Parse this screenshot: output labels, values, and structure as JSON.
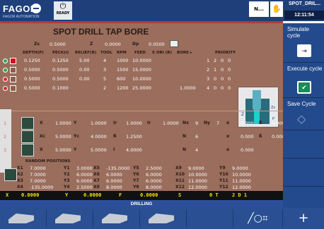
{
  "header": {
    "logo": "FAGOR",
    "logo_sub": "FAGOR AUTOMATION",
    "power_status": "READY",
    "mode_button": "N...",
    "program_name": "SPOT_DRIL...",
    "time": "12:11:54"
  },
  "cycle": {
    "title": "SPOT DRILL TAP BORE",
    "zs": {
      "label": "Zs",
      "value": "0.5000"
    },
    "z": {
      "label": "Z",
      "value": "0.0000"
    },
    "dp": {
      "label": "Dp",
      "value": "0.0500"
    },
    "columns": [
      "DEPTH(P)",
      "PECK(I)",
      "RELIEF(B)",
      "TOOL",
      "RPM",
      "FEED",
      "S ORI (B)",
      "BORE ▸",
      "PRIORITY"
    ],
    "ops": [
      {
        "depth": "0.1250",
        "peck": "0.1250",
        "relief": "5.00",
        "tool": "4",
        "rpm": "1000",
        "feed": "10.0000",
        "sori": "",
        "priority": [
          "1",
          "2",
          "0",
          "0"
        ],
        "color": "#2fa84f"
      },
      {
        "depth": "0.5000",
        "peck": "0.5000",
        "relief": "0.00",
        "tool": "3",
        "rpm": "1500",
        "feed": "15.0000",
        "sori": "",
        "priority": [
          "2",
          "1",
          "0",
          "0"
        ],
        "color": "#2fa84f"
      },
      {
        "depth": "0.5000",
        "peck": "0.5000",
        "relief": "0.00",
        "tool": "5",
        "rpm": "600",
        "feed": "10.0000",
        "sori": "",
        "priority": [
          "3",
          "0",
          "0",
          "0"
        ],
        "color": "#d02a2a"
      },
      {
        "depth": "0.5000",
        "peck": "0.1000",
        "relief": "",
        "tool": "2",
        "rpm": "1200",
        "feed": "25.0000",
        "sori": "1.0000",
        "priority": [
          "4",
          "0",
          "0",
          "0"
        ],
        "color": "#d02a2a"
      }
    ]
  },
  "positions": {
    "rows": [
      {
        "num": "1",
        "a_lbl": "X",
        "a_val": "1.0000",
        "b_lbl": "Y",
        "b_val": "1.0000",
        "c_lbl": "Ir",
        "c_val": "1.0000",
        "d_lbl": "Ir",
        "d_val": "1.0000",
        "e_lbl": "Nx",
        "e_val": "9",
        "f_lbl": "Ny",
        "f_val": "7",
        "g_lbl": "α",
        "g_val": "0.000",
        "h_lbl": "ß",
        "h_val": "0.000"
      },
      {
        "num": "2",
        "a_lbl": "Xc",
        "a_val": "5.0000",
        "b_lbl": "Yc",
        "b_val": "4.0000",
        "c_lbl": "R",
        "c_val": "1.2500",
        "d_lbl": "",
        "d_val": "",
        "e_lbl": "N",
        "e_val": "6",
        "f_lbl": "",
        "f_val": "",
        "g_lbl": "α",
        "g_val": "0.000",
        "h_lbl": "ß",
        "h_val": "0.000"
      },
      {
        "num": "3",
        "a_lbl": "X",
        "a_val": "5.0000",
        "b_lbl": "Y",
        "b_val": "5.0000",
        "c_lbl": "I",
        "c_val": "4.0000",
        "d_lbl": "",
        "d_val": "",
        "e_lbl": "N",
        "e_val": "4",
        "f_lbl": "",
        "f_val": "",
        "g_lbl": "α",
        "g_val": "0.000",
        "h_lbl": "",
        "h_val": ""
      }
    ]
  },
  "random": {
    "title": "RANDOM POSITIONS",
    "rows": [
      [
        [
          "X1",
          "7.0000"
        ],
        [
          "Y1",
          "3.0000"
        ],
        [
          "X5",
          "-135.0000"
        ],
        [
          "Y5",
          "2.5000"
        ],
        [
          "X9",
          "9.0000"
        ],
        [
          "Y9",
          "9.0000"
        ]
      ],
      [
        [
          "X2",
          "7.0000"
        ],
        [
          "Y2",
          "6.0000"
        ],
        [
          "X6",
          "6.0000"
        ],
        [
          "Y6",
          "6.0000"
        ],
        [
          "X10",
          "10.0000"
        ],
        [
          "Y10",
          "10.0000"
        ]
      ],
      [
        [
          "X3",
          "7.0000"
        ],
        [
          "Y3",
          "6.0000"
        ],
        [
          "X7",
          "6.0000"
        ],
        [
          "Y7",
          "6.0000"
        ],
        [
          "X11",
          "11.0000"
        ],
        [
          "Y11",
          "11.0000"
        ]
      ],
      [
        [
          "X4",
          "-135.0000"
        ],
        [
          "Y4",
          "2.5000"
        ],
        [
          "X8",
          "8.0000"
        ],
        [
          "Y8",
          "8.0000"
        ],
        [
          "X12",
          "12.0000"
        ],
        [
          "Y12",
          "12.0000"
        ]
      ]
    ]
  },
  "status": {
    "x_lbl": "X",
    "x_val": "0.0000",
    "y_lbl": "Y",
    "y_val": "0.0000",
    "f_lbl": "F",
    "f_val": "0.0000",
    "s_lbl": "S",
    "t_lbl": "0 T",
    "d_lbl": "2 D 1",
    "operation": "DRILLING"
  },
  "sidebar": {
    "simulate": "Simulate cycle",
    "execute": "Execute cycle",
    "save": "Save Cycle"
  },
  "icons": [
    "power-icon",
    "hand-icon",
    "exit-icon",
    "check-icon",
    "diamond-icon",
    "grid-icon",
    "plus-icon"
  ]
}
